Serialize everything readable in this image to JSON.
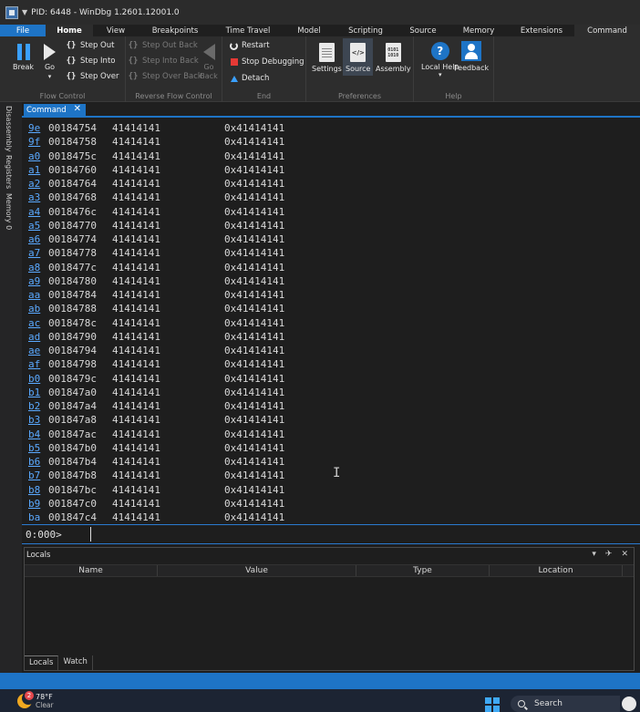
{
  "title": {
    "pid": "PID: 6448",
    "app": "WinDbg 1.2601.12001.0"
  },
  "menu_tabs": [
    "File",
    "Home",
    "View",
    "Breakpoints",
    "Time Travel",
    "Model",
    "Scripting",
    "Source",
    "Memory",
    "Extensions",
    "Command"
  ],
  "ribbon": {
    "flow_control": {
      "label": "Flow Control",
      "break": "Break",
      "go": "Go",
      "step_out": "Step Out",
      "step_into": "Step Into",
      "step_over": "Step Over"
    },
    "reverse_flow": {
      "label": "Reverse Flow Control",
      "step_out_back": "Step Out Back",
      "step_into_back": "Step Into Back",
      "step_over_back": "Step Over Back",
      "go_back": "Go Back"
    },
    "end": {
      "label": "End",
      "restart": "Restart",
      "stop": "Stop Debugging",
      "detach": "Detach"
    },
    "preferences": {
      "label": "Preferences",
      "settings": "Settings",
      "source": "Source",
      "assembly": "Assembly"
    },
    "help": {
      "label": "Help",
      "local_help": "Local Help",
      "feedback": "Feedback"
    }
  },
  "left_tabs": [
    "Disassembly",
    "Registers",
    "Memory 0"
  ],
  "command": {
    "tab_label": "Command",
    "prompt": "0:000>",
    "input_value": "",
    "rows": [
      [
        "9e",
        "00184754",
        "41414141",
        "0x41414141"
      ],
      [
        "9f",
        "00184758",
        "41414141",
        "0x41414141"
      ],
      [
        "a0",
        "0018475c",
        "41414141",
        "0x41414141"
      ],
      [
        "a1",
        "00184760",
        "41414141",
        "0x41414141"
      ],
      [
        "a2",
        "00184764",
        "41414141",
        "0x41414141"
      ],
      [
        "a3",
        "00184768",
        "41414141",
        "0x41414141"
      ],
      [
        "a4",
        "0018476c",
        "41414141",
        "0x41414141"
      ],
      [
        "a5",
        "00184770",
        "41414141",
        "0x41414141"
      ],
      [
        "a6",
        "00184774",
        "41414141",
        "0x41414141"
      ],
      [
        "a7",
        "00184778",
        "41414141",
        "0x41414141"
      ],
      [
        "a8",
        "0018477c",
        "41414141",
        "0x41414141"
      ],
      [
        "a9",
        "00184780",
        "41414141",
        "0x41414141"
      ],
      [
        "aa",
        "00184784",
        "41414141",
        "0x41414141"
      ],
      [
        "ab",
        "00184788",
        "41414141",
        "0x41414141"
      ],
      [
        "ac",
        "0018478c",
        "41414141",
        "0x41414141"
      ],
      [
        "ad",
        "00184790",
        "41414141",
        "0x41414141"
      ],
      [
        "ae",
        "00184794",
        "41414141",
        "0x41414141"
      ],
      [
        "af",
        "00184798",
        "41414141",
        "0x41414141"
      ],
      [
        "b0",
        "0018479c",
        "41414141",
        "0x41414141"
      ],
      [
        "b1",
        "001847a0",
        "41414141",
        "0x41414141"
      ],
      [
        "b2",
        "001847a4",
        "41414141",
        "0x41414141"
      ],
      [
        "b3",
        "001847a8",
        "41414141",
        "0x41414141"
      ],
      [
        "b4",
        "001847ac",
        "41414141",
        "0x41414141"
      ],
      [
        "b5",
        "001847b0",
        "41414141",
        "0x41414141"
      ],
      [
        "b6",
        "001847b4",
        "41414141",
        "0x41414141"
      ],
      [
        "b7",
        "001847b8",
        "41414141",
        "0x41414141"
      ],
      [
        "b8",
        "001847bc",
        "41414141",
        "0x41414141"
      ],
      [
        "b9",
        "001847c0",
        "41414141",
        "0x41414141"
      ],
      [
        "ba",
        "001847c4",
        "41414141",
        "0x41414141"
      ]
    ]
  },
  "locals": {
    "title": "Locals",
    "columns": [
      "Name",
      "Value",
      "Type",
      "Location"
    ],
    "tabs": [
      "Locals",
      "Watch"
    ]
  },
  "taskbar": {
    "temp": "78°F",
    "condition": "Clear",
    "badge": "2",
    "search": "Search"
  },
  "colors": {
    "accent": "#1e74c6",
    "link": "#5aa9ff",
    "background": "#1e1e1e"
  }
}
